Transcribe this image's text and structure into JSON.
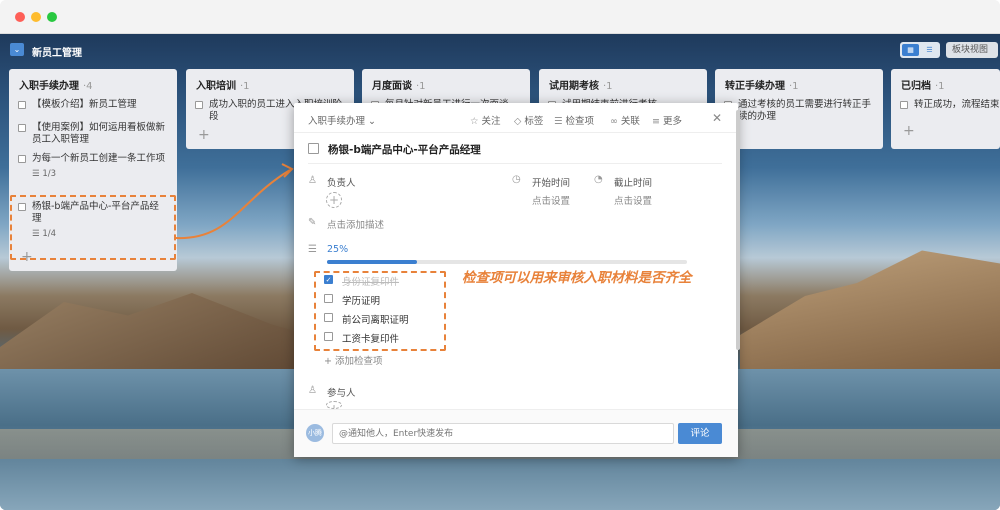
{
  "board": {
    "title": "新员工管理",
    "view_select": "板块视图",
    "view_toggle": [
      "▦",
      "☰"
    ]
  },
  "columns": [
    {
      "title": "入职手续办理",
      "count": "·4",
      "cards": [
        {
          "text": "【模板介绍】新员工管理",
          "sub": ""
        },
        {
          "text": "【使用案例】如何运用看板做新员工入职管理",
          "sub": ""
        },
        {
          "text": "为每一个新员工创建一条工作项",
          "sub": "1/3"
        },
        {
          "text": "杨银-b端产品中心-平台产品经理",
          "sub": "1/4"
        }
      ]
    },
    {
      "title": "入职培训",
      "count": "·1",
      "cards": [
        {
          "text": "成功入职的员工进入入职培训阶段",
          "sub": ""
        }
      ]
    },
    {
      "title": "月度面谈",
      "count": "·1",
      "cards": [
        {
          "text": "每月针对新员工进行一次面谈",
          "sub": ""
        }
      ]
    },
    {
      "title": "试用期考核",
      "count": "·1",
      "cards": [
        {
          "text": "试用期结束前进行考核",
          "sub": ""
        }
      ]
    },
    {
      "title": "转正手续办理",
      "count": "·1",
      "cards": [
        {
          "text": "通过考核的员工需要进行转正手续的办理",
          "sub": ""
        }
      ]
    },
    {
      "title": "已归档",
      "count": "·1",
      "cards": [
        {
          "text": "转正成功，流程结束",
          "sub": ""
        }
      ]
    }
  ],
  "modal": {
    "crumb": "入职手续办理 ⌄",
    "actions": {
      "follow": "关注",
      "tag": "标签",
      "checklist": "检查项",
      "link": "关联",
      "more": "更多"
    },
    "task_title": "杨银-b端产品中心-平台产品经理",
    "owner_label": "负责人",
    "start_label": "开始时间",
    "start_value": "点击设置",
    "due_label": "截止时间",
    "due_value": "点击设置",
    "desc_placeholder": "点击添加描述",
    "progress_text": "25%",
    "progress": 0.25,
    "checklist": [
      {
        "label": "身份证复印件",
        "done": true
      },
      {
        "label": "学历证明",
        "done": false
      },
      {
        "label": "前公司离职证明",
        "done": false
      },
      {
        "label": "工资卡复印件",
        "done": false
      }
    ],
    "add_check": "+ 添加检查项",
    "participants_label": "参与人",
    "comment_placeholder": "@通知他人，Enter快速发布",
    "comment_button": "评论",
    "avatar_text": "小腾"
  },
  "annotation": "检查项可以用来审核入职材料是否齐全",
  "colors": {
    "accent": "#3b7fd0",
    "callout": "#e8823a"
  }
}
